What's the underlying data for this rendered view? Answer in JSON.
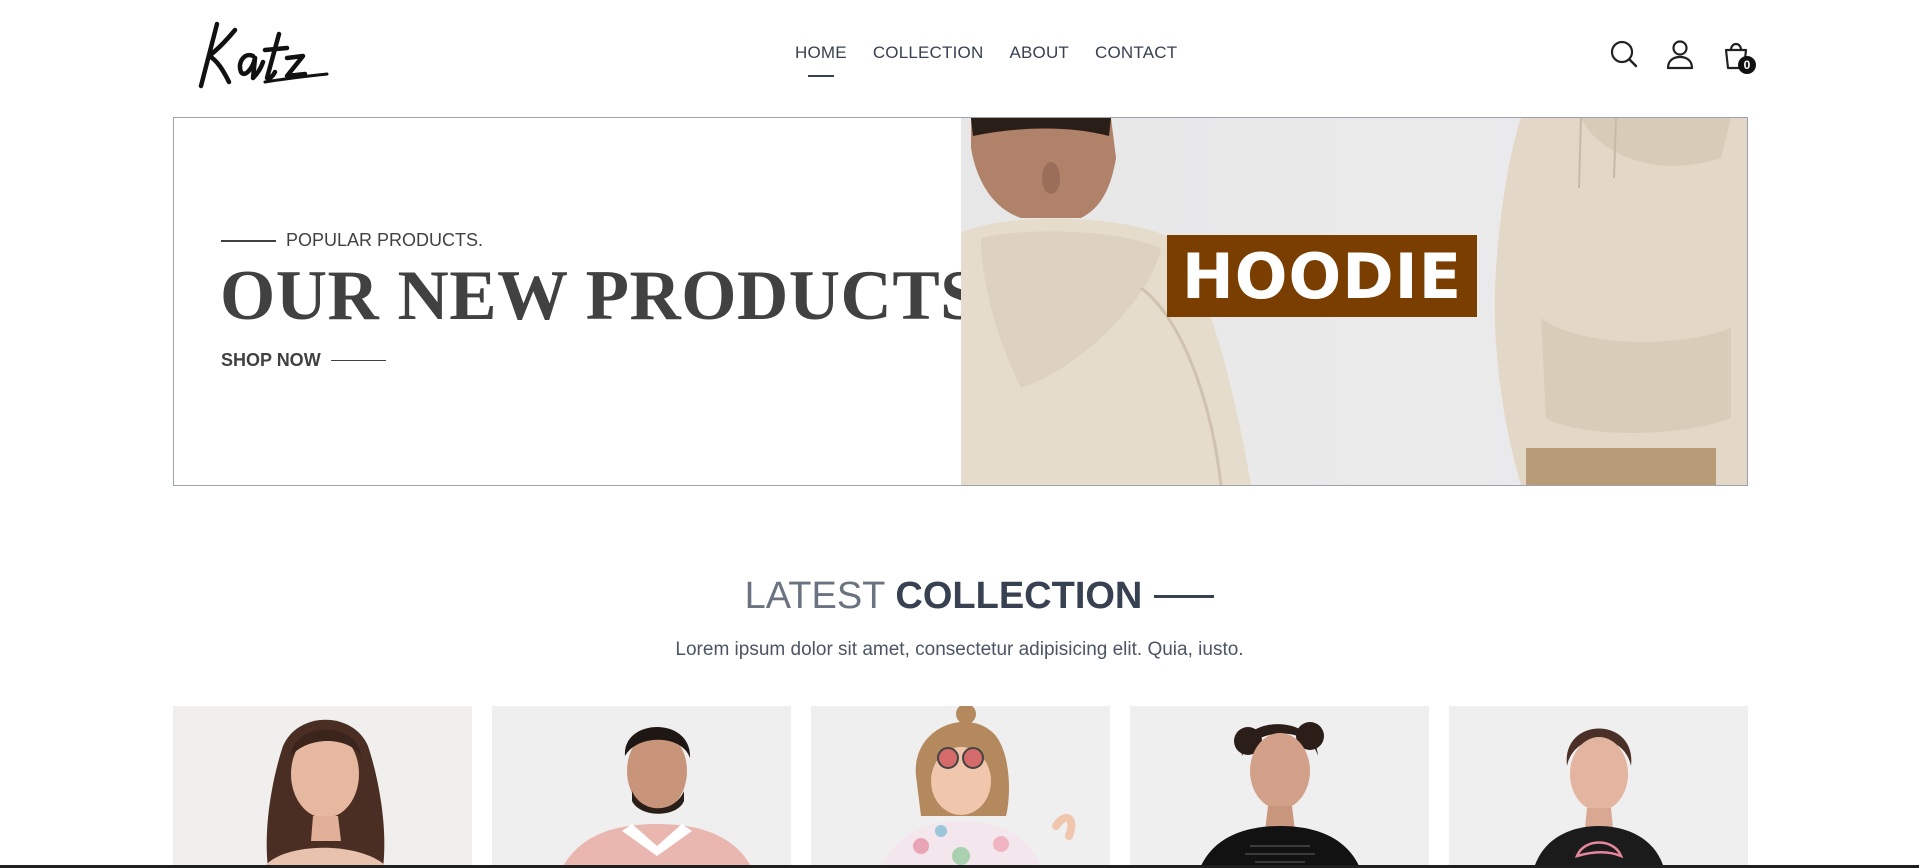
{
  "header": {
    "logo_text": "Katz",
    "nav": [
      {
        "label": "HOME",
        "active": true
      },
      {
        "label": "COLLECTION",
        "active": false
      },
      {
        "label": "ABOUT",
        "active": false
      },
      {
        "label": "CONTACT",
        "active": false
      }
    ],
    "icons": [
      "search-icon",
      "user-icon",
      "cart-icon"
    ],
    "cart_count": "0"
  },
  "hero": {
    "kicker": "POPULAR PRODUCTS.",
    "title": "OUR NEW PRODUCTS",
    "cta": "SHOP NOW",
    "image_label": "HOODIE",
    "label_color": "#7a3e00"
  },
  "collection": {
    "title_light": "LATEST",
    "title_bold": "COLLECTION",
    "description": "Lorem ipsum dolor sit amet, consectetur adipisicing elit. Quia, iusto.",
    "products": [
      {
        "image": "woman-off-shoulder-top-photo"
      },
      {
        "image": "man-pink-polo-photo"
      },
      {
        "image": "girl-floral-dress-sunglasses-photo"
      },
      {
        "image": "man-black-tshirt-photo"
      },
      {
        "image": "woman-black-puma-tshirt-photo"
      }
    ]
  },
  "colors": {
    "text": "#374151",
    "heading_dark": "#414141",
    "border": "#9ca3af"
  }
}
